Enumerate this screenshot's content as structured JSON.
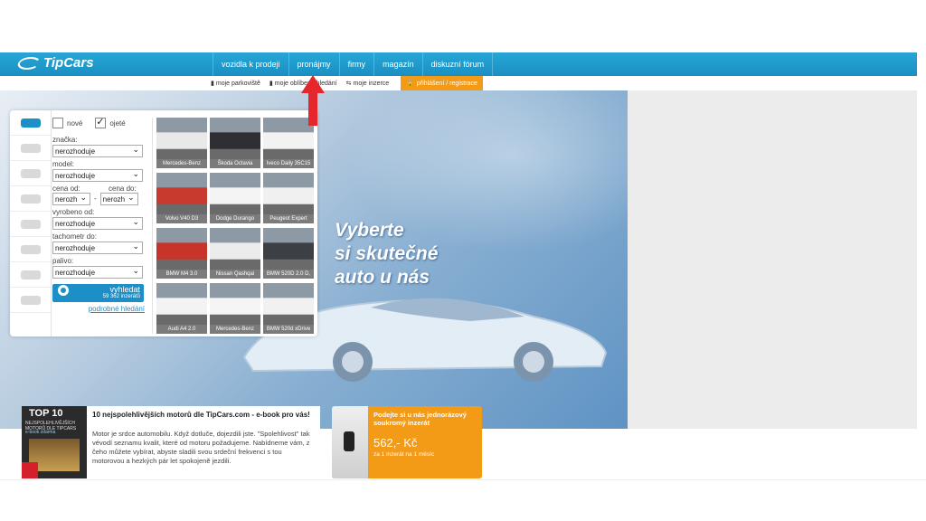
{
  "brand": {
    "name": "TipCars"
  },
  "nav": {
    "items": [
      "vozidla k prodeji",
      "pronájmy",
      "firmy",
      "magazín",
      "diskuzní fórum"
    ]
  },
  "subnav": {
    "parking": "moje parkoviště",
    "searches": "moje oblíbená hledání",
    "ads": "moje inzerce",
    "login": "přihlášení / registrace"
  },
  "hero": {
    "line1": "Vyberte",
    "line2": "si skutečné",
    "line3": "auto u nás"
  },
  "search": {
    "new_label": "nové",
    "used_label": "ojeté",
    "brand_label": "značka:",
    "brand_value": "nerozhoduje",
    "model_label": "model:",
    "model_value": "nerozhoduje",
    "price_from_label": "cena od:",
    "price_to_label": "cena do:",
    "price_from_value": "nerozh",
    "price_to_value": "nerozh",
    "produced_label": "vyrobeno od:",
    "produced_value": "nerozhoduje",
    "odometer_label": "tachometr do:",
    "odometer_value": "nerozhoduje",
    "fuel_label": "palivo:",
    "fuel_value": "nerozhoduje",
    "button_label": "vyhledat",
    "button_count": "59 362 inzerátů",
    "detail_link": "podrobné hledání"
  },
  "cars": [
    {
      "name": "Mercedes-Benz",
      "color": "#e9e9e9"
    },
    {
      "name": "Škoda Octavia",
      "color": "#2f2f33"
    },
    {
      "name": "Iveco Daily 35C15",
      "color": "#f2f2f2"
    },
    {
      "name": "Volvo V40 D3",
      "color": "#c8392e"
    },
    {
      "name": "Dodge Durango",
      "color": "#f4f4f4"
    },
    {
      "name": "Peugeot Expert",
      "color": "#f0f0f0"
    },
    {
      "name": "BMW M4 3.0",
      "color": "#c7352a"
    },
    {
      "name": "Nissan Qashqai",
      "color": "#ececec"
    },
    {
      "name": "BMW 520D 2.0 D,",
      "color": "#3c3f44"
    },
    {
      "name": "Audi A4 2.0",
      "color": "#f3f3f3"
    },
    {
      "name": "Mercedes-Benz",
      "color": "#f5f5f5"
    },
    {
      "name": "BMW 520d xDrive",
      "color": "#f1f1f1"
    }
  ],
  "promo": {
    "book_title": "TOP 10",
    "book_sub": "NEJSPOLEHLIVĚJŠÍCH MOTORŮ DLE TIPCARS",
    "book_sub2": "e-book zdarma",
    "title": "10 nejspolehlivějších motorů dle TipCars.com - e-book pro vás!",
    "body": "Motor je srdce automobilu. Když dotluče, dojezdili jste. \"Spolehlivost\" tak vévodí seznamu kvalit, které od motoru požadujeme. Nabídneme vám, z čeho můžete vybírat, abyste sladili svou srdeční frekvenci s tou motorovou a hezkých pár let spokojeně jezdili."
  },
  "offer": {
    "title": "Podejte si u nás jednorázový soukromý inzerát",
    "price": "562,- Kč",
    "note": "za 1 inzerát na 1 měsíc"
  },
  "colors": {
    "nav": "#1e9bd0",
    "accent": "#f39a17",
    "link": "#1c8fc8",
    "arrow": "#e5262d"
  }
}
